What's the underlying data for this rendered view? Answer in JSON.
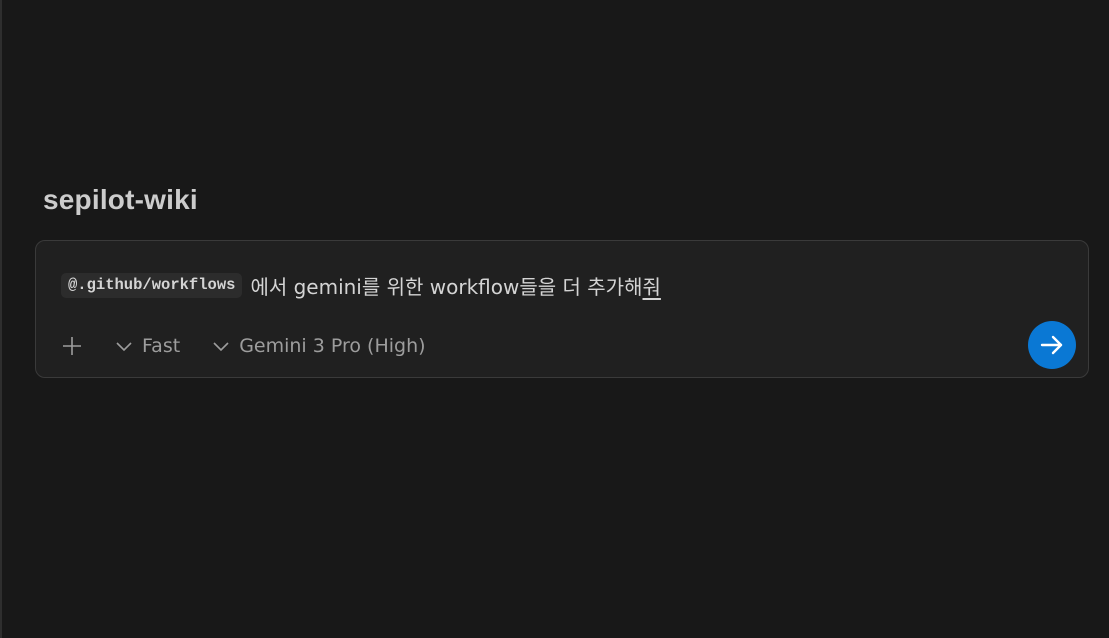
{
  "project": {
    "title": "sepilot-wiki"
  },
  "chat_input": {
    "mention": "@.github/workflows",
    "text_main": "에서 gemini를 위한 workflow들을 더 추가해",
    "text_last": "줘"
  },
  "toolbar": {
    "add_icon": "plus-icon",
    "mode_label": "Fast",
    "model_label": "Gemini 3 Pro (High)",
    "dropdown_icon": "chevron-down-icon",
    "send_icon": "arrow-right-icon"
  },
  "colors": {
    "background": "#181818",
    "panel": "#202020",
    "accent": "#0a78d4",
    "text": "#d4d4d4",
    "muted": "#9d9d9d"
  }
}
